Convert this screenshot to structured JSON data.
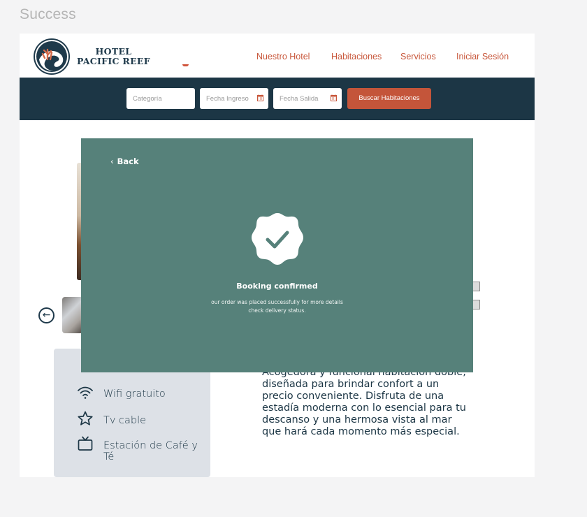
{
  "frame": {
    "label": "Success"
  },
  "header": {
    "logo_line1": "HOTEL",
    "logo_line2": "PACIFIC REEF",
    "nav": [
      "Nuestro Hotel",
      "Habitaciones",
      "Servicios",
      "Iniciar Sesión"
    ]
  },
  "search": {
    "category_placeholder": "Categoría",
    "checkin_placeholder": "Fecha Ingreso",
    "checkout_placeholder": "Fecha Salida",
    "button_label": "Buscar Habitaciones"
  },
  "amenities": {
    "items": [
      {
        "label": "Wifi gratuito",
        "icon": "wifi-icon"
      },
      {
        "label": "Tv cable",
        "icon": "star-icon"
      },
      {
        "label": "Estación de Café y Té",
        "icon": "tv-icon"
      }
    ]
  },
  "room": {
    "description": "Acogedora y funcional habitación doble, diseñada para brindar confort a un precio conveniente. Disfruta de una estadía moderna con lo esencial para tu descanso y una hermosa vista al mar que hará cada momento más especial."
  },
  "modal": {
    "back_label": "Back",
    "title": "Booking confirmed",
    "subtitle": "our order was placed successfully for more details check delivery status."
  },
  "colors": {
    "accent": "#c8573b",
    "navy": "#1c3645",
    "modal": "#56817a"
  }
}
